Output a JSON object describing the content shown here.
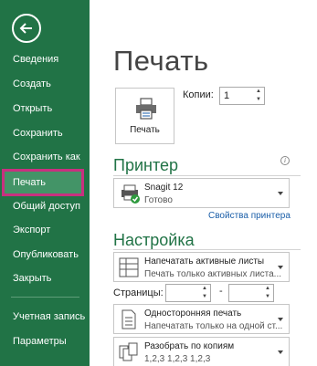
{
  "sidebar": {
    "back_icon": "arrow-left-icon",
    "items": [
      {
        "label": "Сведения"
      },
      {
        "label": "Создать"
      },
      {
        "label": "Открыть"
      },
      {
        "label": "Сохранить"
      },
      {
        "label": "Сохранить как"
      },
      {
        "label": "Печать",
        "active": true
      },
      {
        "label": "Общий доступ"
      },
      {
        "label": "Экспорт"
      },
      {
        "label": "Опубликовать"
      },
      {
        "label": "Закрыть"
      },
      {
        "label": "Учетная запись"
      },
      {
        "label": "Параметры"
      }
    ]
  },
  "main": {
    "title": "Печать",
    "print_button_label": "Печать",
    "copies_label": "Копии:",
    "copies_value": "1",
    "printer_section": "Принтер",
    "printer": {
      "name": "Snagit 12",
      "status": "Готово"
    },
    "printer_properties_link": "Свойства принтера",
    "settings_section": "Настройка",
    "setting_what": {
      "title": "Напечатать активные листы",
      "desc": "Печать только активных листа..."
    },
    "pages_label": "Страницы:",
    "pages_dash": "-",
    "setting_sides": {
      "title": "Односторонняя печать",
      "desc": "Напечатать только на одной ст..."
    },
    "setting_collate": {
      "title": "Разобрать по копиям",
      "desc": "1,2,3    1,2,3    1,2,3"
    }
  },
  "colors": {
    "accent": "#217346",
    "active_item": "#439467",
    "highlight_frame": "#c8307f",
    "link": "#1a5ea8"
  }
}
